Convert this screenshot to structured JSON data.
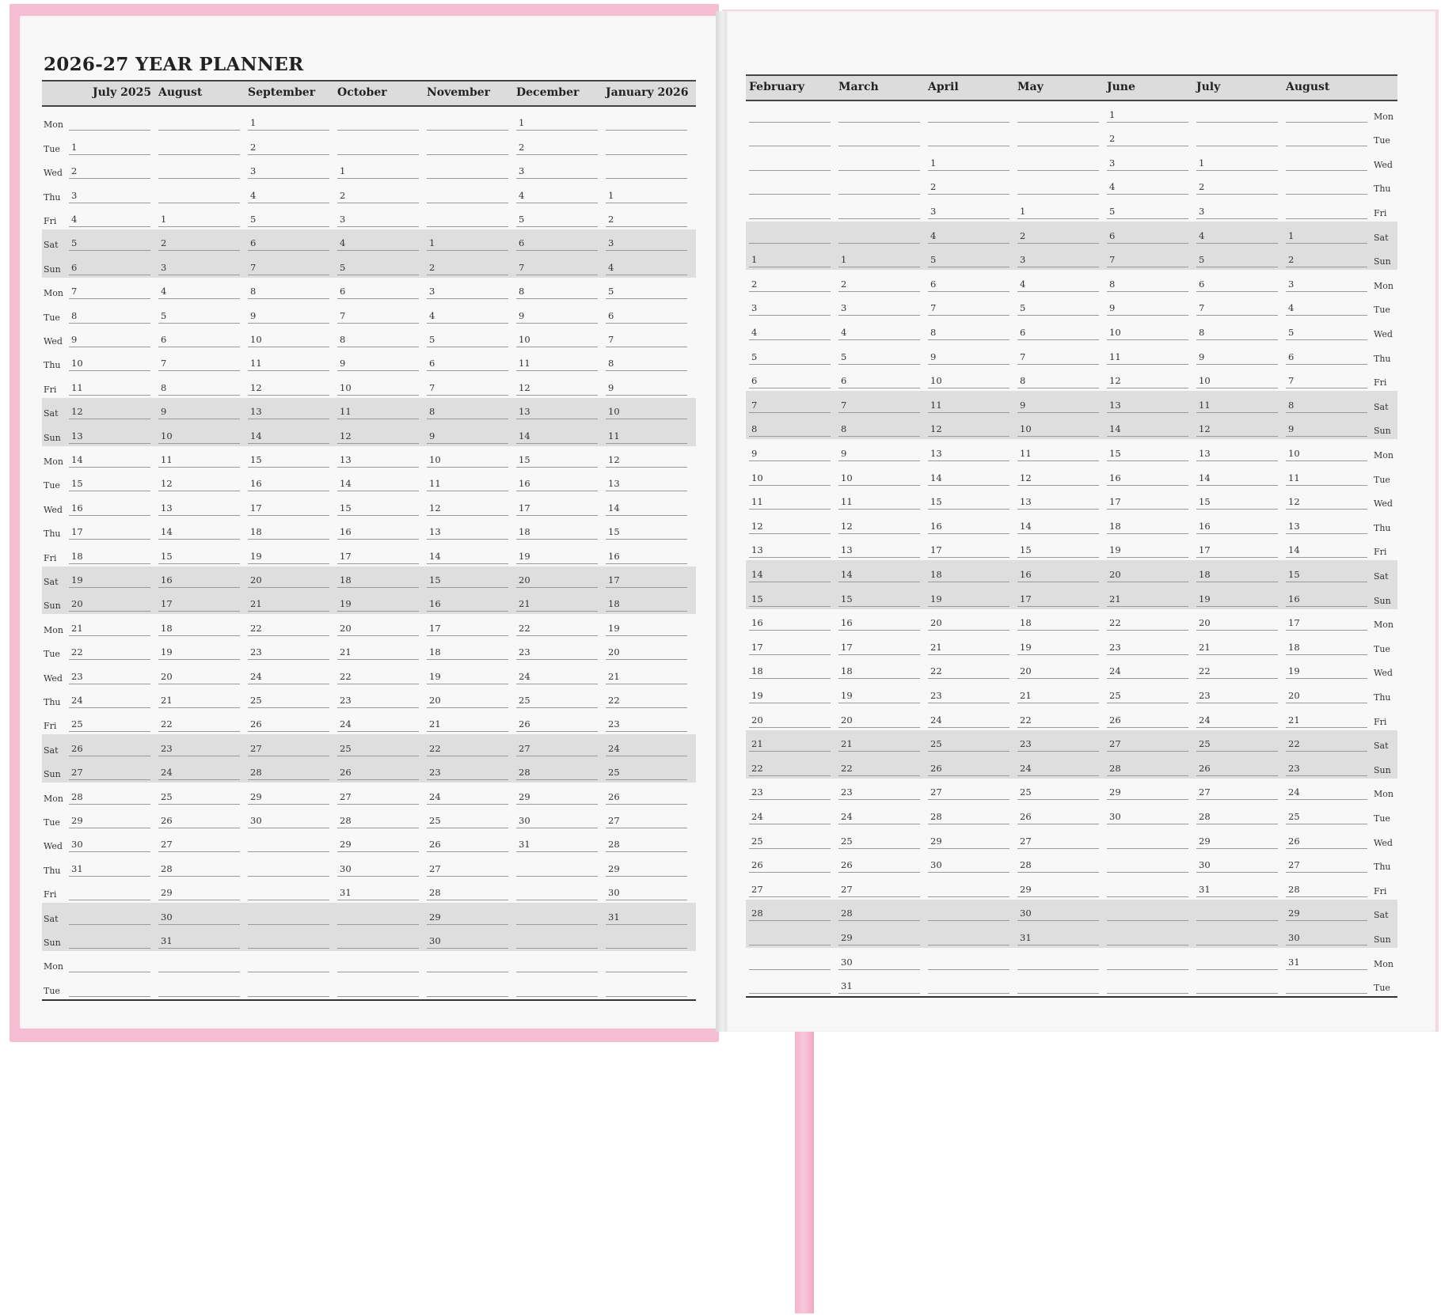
{
  "title": "2026-27 YEAR PLANNER",
  "weekdays": [
    "Mon",
    "Tue",
    "Wed",
    "Thu",
    "Fri",
    "Sat",
    "Sun"
  ],
  "left_page": {
    "months": [
      {
        "label": "July 2025",
        "start": 1,
        "days": 31
      },
      {
        "label": "August",
        "start": 4,
        "days": 31
      },
      {
        "label": "September",
        "start": 0,
        "days": 30
      },
      {
        "label": "October",
        "start": 2,
        "days": 31
      },
      {
        "label": "November",
        "start": 5,
        "days": 30
      },
      {
        "label": "December",
        "start": 0,
        "days": 31
      },
      {
        "label": "January 2026",
        "start": 3,
        "days": 31
      }
    ]
  },
  "right_page": {
    "months": [
      {
        "label": "February",
        "start": 6,
        "days": 28
      },
      {
        "label": "March",
        "start": 6,
        "days": 31
      },
      {
        "label": "April",
        "start": 2,
        "days": 30
      },
      {
        "label": "May",
        "start": 4,
        "days": 31
      },
      {
        "label": "June",
        "start": 0,
        "days": 30
      },
      {
        "label": "July",
        "start": 2,
        "days": 31
      },
      {
        "label": "August",
        "start": 5,
        "days": 31
      }
    ]
  },
  "row_count": 37,
  "colors": {
    "cover": "#f5bed3",
    "ribbon": "#f7bdd2",
    "weekend_band": "#dedede",
    "page": "#f8f8f8"
  }
}
